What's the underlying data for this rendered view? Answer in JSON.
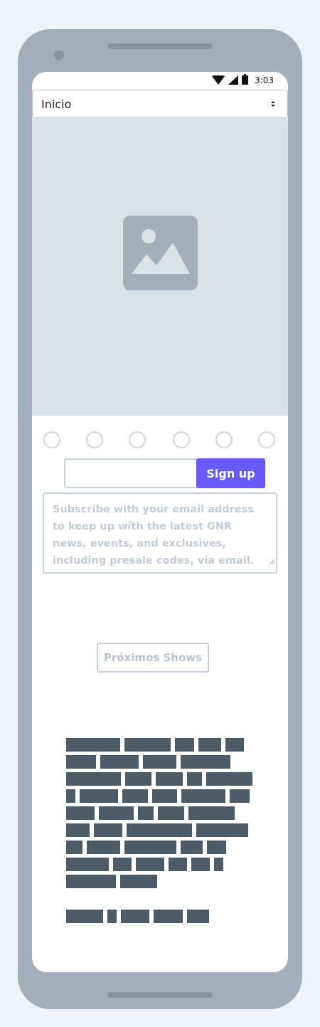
{
  "status_bar": {
    "time": "3:03",
    "icons": [
      "wifi-icon",
      "signal-icon",
      "battery-icon"
    ]
  },
  "nav": {
    "selected": "Inicio"
  },
  "hero": {
    "icon": "image-placeholder-icon"
  },
  "carousel": {
    "dot_count": 6
  },
  "signup": {
    "email_value": "",
    "button_label": "Sign up",
    "accent_color": "#6a5af9"
  },
  "subscribe": {
    "placeholder": "Subscribe with your email address to keep up with the latest GNR news, events, and exclusives, including presale codes, via email."
  },
  "shows": {
    "button_label": "Próximos Shows"
  },
  "colors": {
    "phone_frame": "#a0afbb",
    "hero_bg": "#dae1e7",
    "text_block": "#4b5a67"
  }
}
